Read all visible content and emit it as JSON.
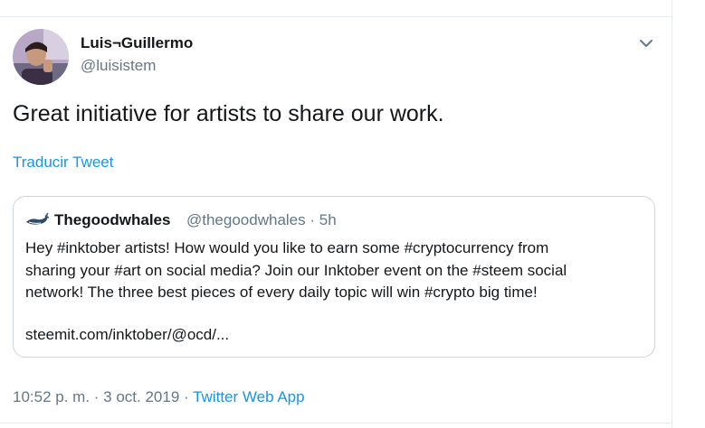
{
  "tweet": {
    "author": {
      "name": "Luis¬Guillermo",
      "handle": "@luisistem"
    },
    "text": "Great initiative for artists to share our work.",
    "translate_label": "Traducir Tweet",
    "quoted": {
      "name": "Thegoodwhales",
      "handle": "@thegoodwhales",
      "separator": "·",
      "time": "5h",
      "lines": [
        "Hey #inktober artists! How would you like to earn some #cryptocurrency from",
        "sharing your #art on social media? Join our Inktober event on the #steem social",
        "network! The three best pieces of every daily topic will win #crypto big time!",
        "steemit.com/inktober/@ocd/..."
      ]
    },
    "footer": {
      "timestamp": "10:52 p. m. · 3 oct. 2019",
      "separator": "·",
      "source": "Twitter Web App"
    }
  },
  "colors": {
    "link": "#1b95e0",
    "secondary_text": "#657786",
    "border": "#ccd6dd"
  },
  "icons": {
    "caret": "chevron-down-icon"
  }
}
